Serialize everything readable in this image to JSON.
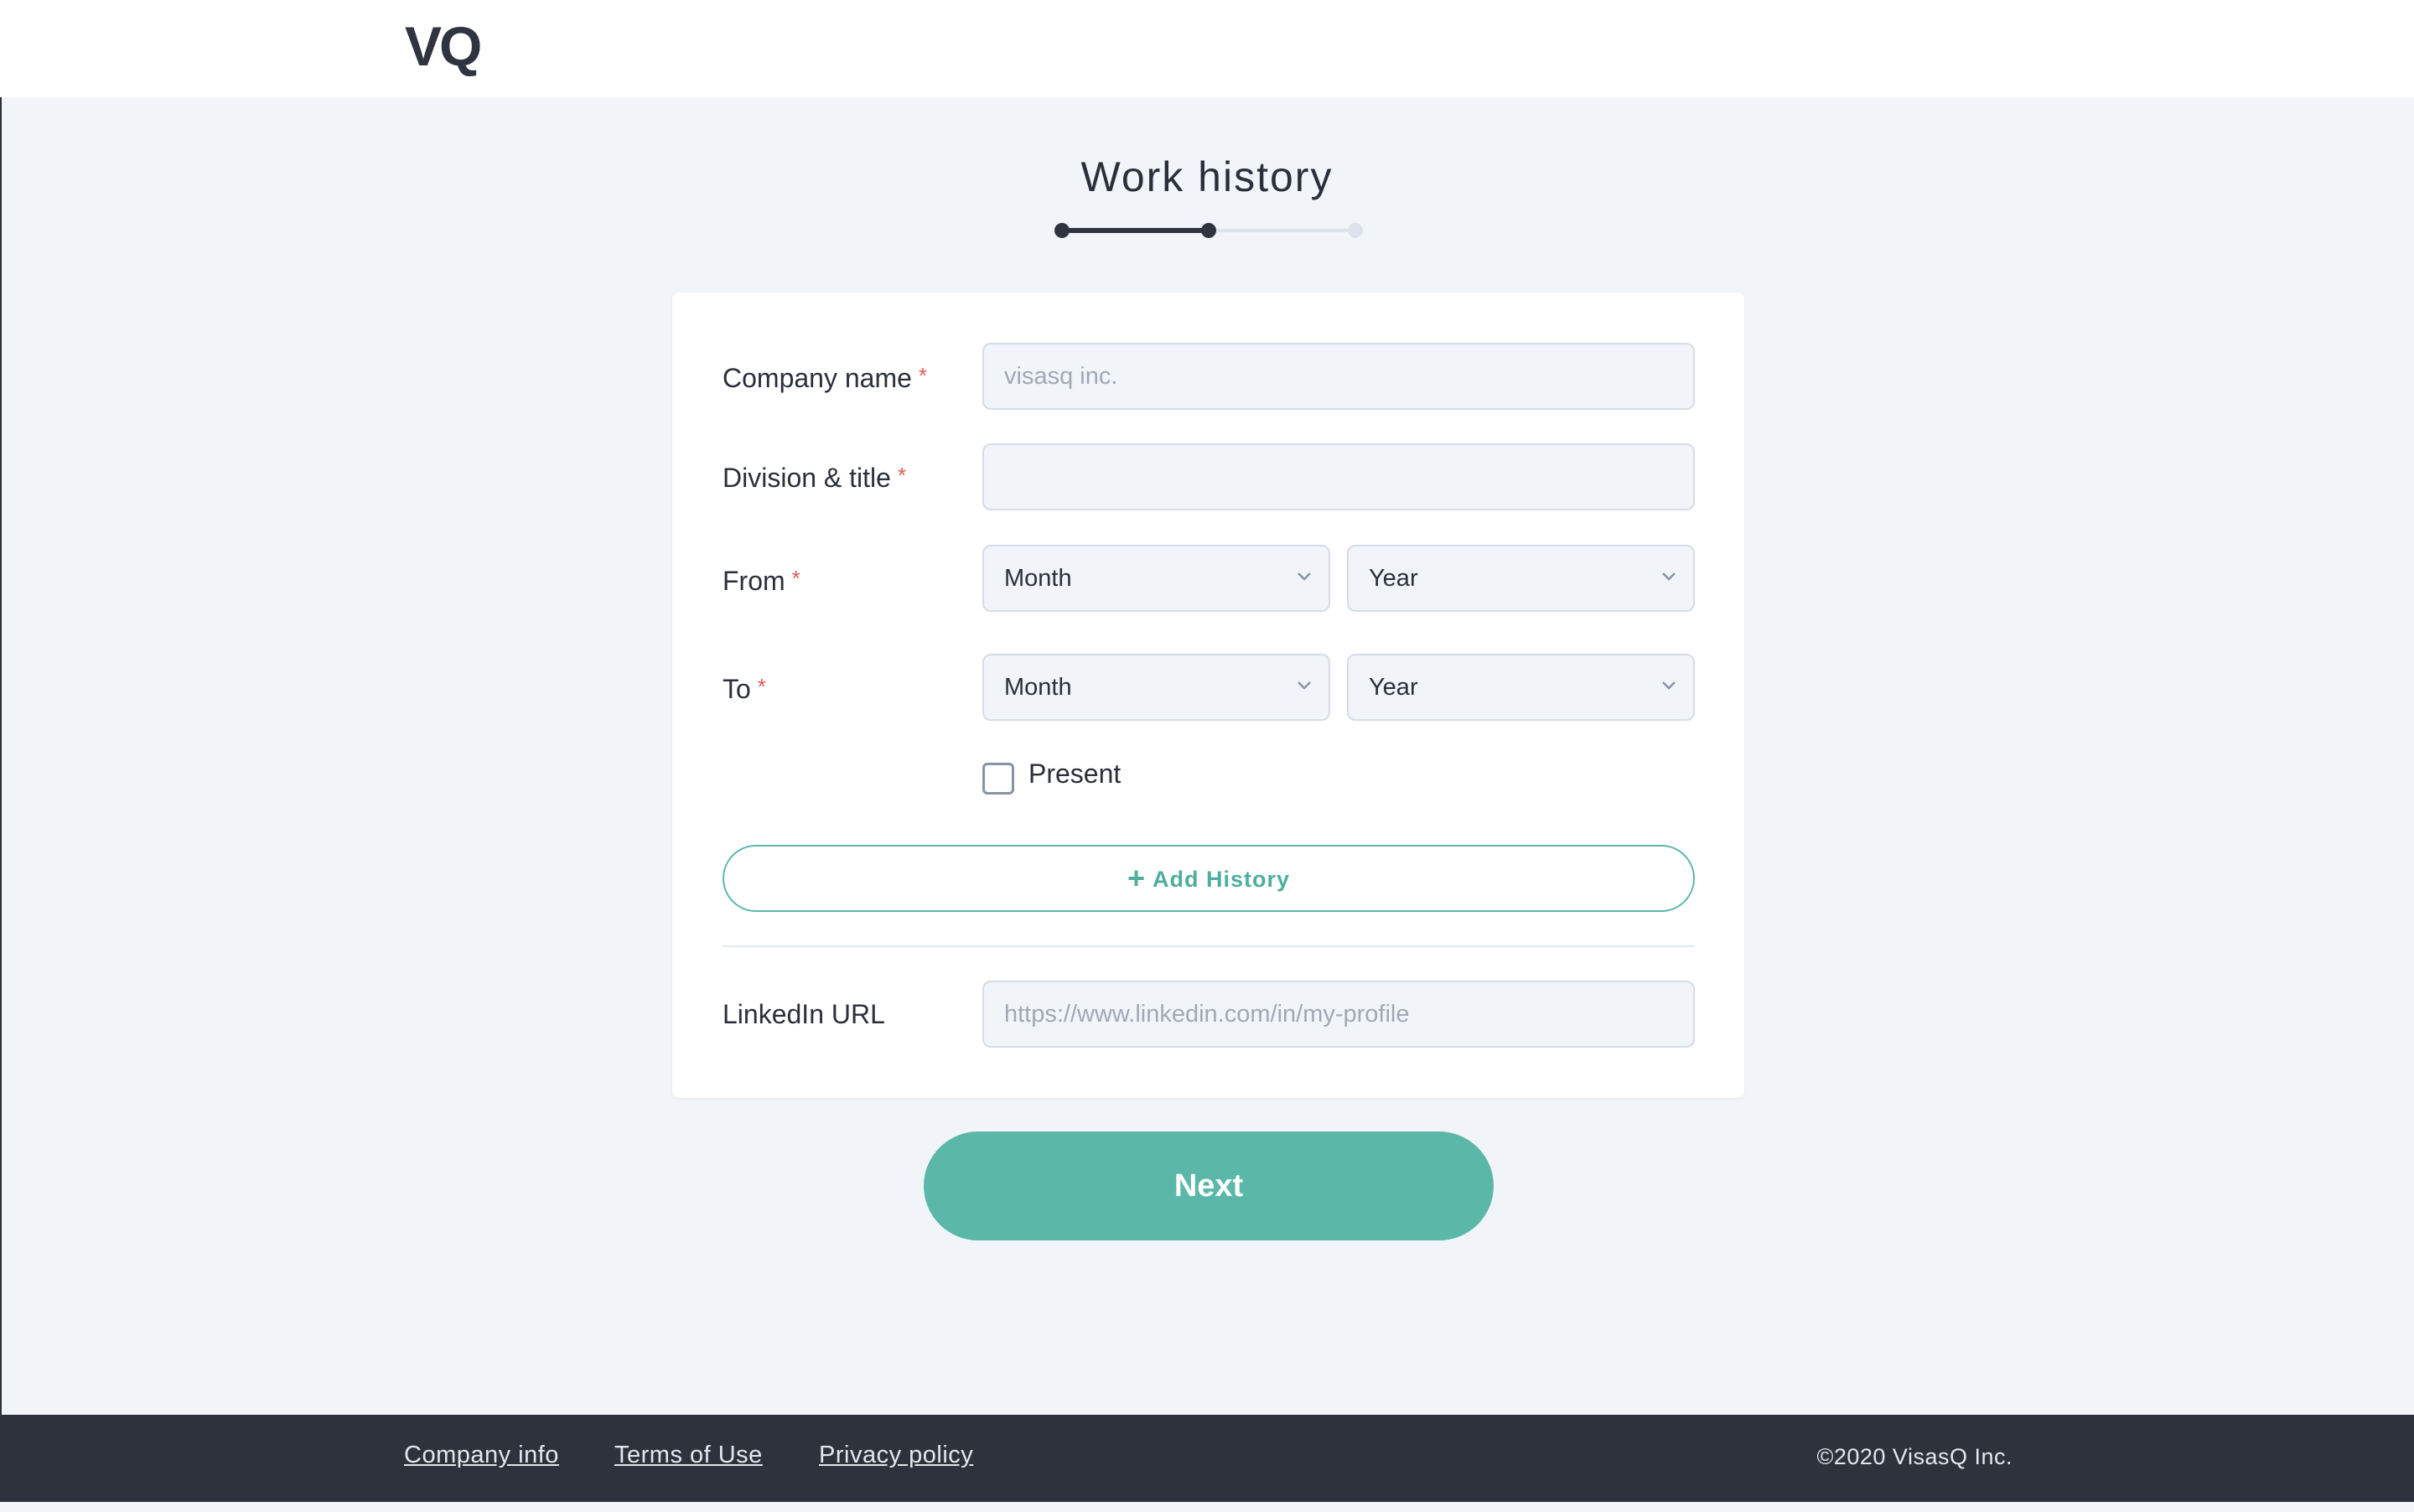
{
  "header": {
    "logo": "VQ"
  },
  "title": "Work history",
  "progress": {
    "total_steps": 3,
    "current_step": 2
  },
  "form": {
    "company": {
      "label": "Company name",
      "required_mark": "*",
      "value": "",
      "placeholder": "visasq inc."
    },
    "division": {
      "label": "Division & title",
      "required_mark": "*",
      "value": "",
      "placeholder": ""
    },
    "from": {
      "label": "From",
      "required_mark": "*",
      "month": "Month",
      "year": "Year"
    },
    "to": {
      "label": "To",
      "required_mark": "*",
      "month": "Month",
      "year": "Year"
    },
    "present": {
      "label": "Present",
      "checked": false
    },
    "add_history": {
      "label": "Add History",
      "icon": "plus-icon"
    },
    "linkedin": {
      "label": "LinkedIn URL",
      "value": "",
      "placeholder": "https://www.linkedin.com/in/my-profile"
    }
  },
  "next_button": "Next",
  "footer": {
    "links": [
      "Company info",
      "Terms of Use",
      "Privacy policy"
    ],
    "copyright": "©2020 VisasQ Inc."
  },
  "colors": {
    "accent": "#5bb8a8",
    "dark": "#2e323c",
    "background": "#f1f5f9",
    "required": "#e05a5a"
  }
}
